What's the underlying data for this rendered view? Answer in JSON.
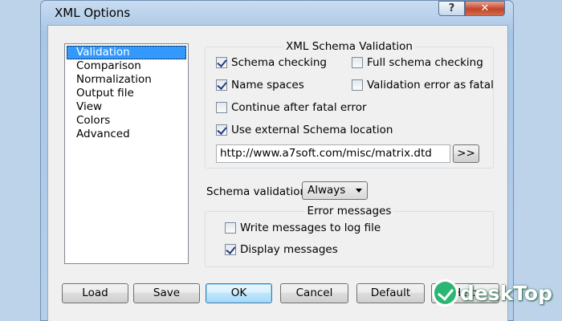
{
  "window": {
    "title": "XML Options",
    "help_label": "?",
    "close_label": "✕"
  },
  "categories": [
    {
      "label": "Validation",
      "selected": true
    },
    {
      "label": "Comparison"
    },
    {
      "label": "Normalization"
    },
    {
      "label": "Output file"
    },
    {
      "label": "View"
    },
    {
      "label": "Colors"
    },
    {
      "label": "Advanced"
    }
  ],
  "schema_group": {
    "title": "XML Schema Validation",
    "schema_checking": {
      "label": "Schema checking",
      "checked": true
    },
    "full_schema_checking": {
      "label": "Full schema checking",
      "checked": false
    },
    "name_spaces": {
      "label": "Name spaces",
      "checked": true
    },
    "validation_error_fatal": {
      "label": "Validation error as fatal",
      "checked": false
    },
    "continue_after_fatal": {
      "label": "Continue after fatal error",
      "checked": false
    },
    "use_external_schema": {
      "label": "Use external Schema location",
      "checked": true
    },
    "schema_location": "http://www.a7soft.com/misc/matrix.dtd",
    "browse_label": ">>"
  },
  "schema_validation": {
    "label": "Schema validation:",
    "selected": "Always"
  },
  "error_group": {
    "title": "Error messages",
    "write_log": {
      "label": "Write messages to log file",
      "checked": false
    },
    "display_messages": {
      "label": "Display messages",
      "checked": true
    }
  },
  "buttons": {
    "load": "Load",
    "save": "Save",
    "ok": "OK",
    "cancel": "Cancel",
    "default": "Default",
    "help": "Help"
  },
  "watermark": {
    "text": "deskTop"
  }
}
